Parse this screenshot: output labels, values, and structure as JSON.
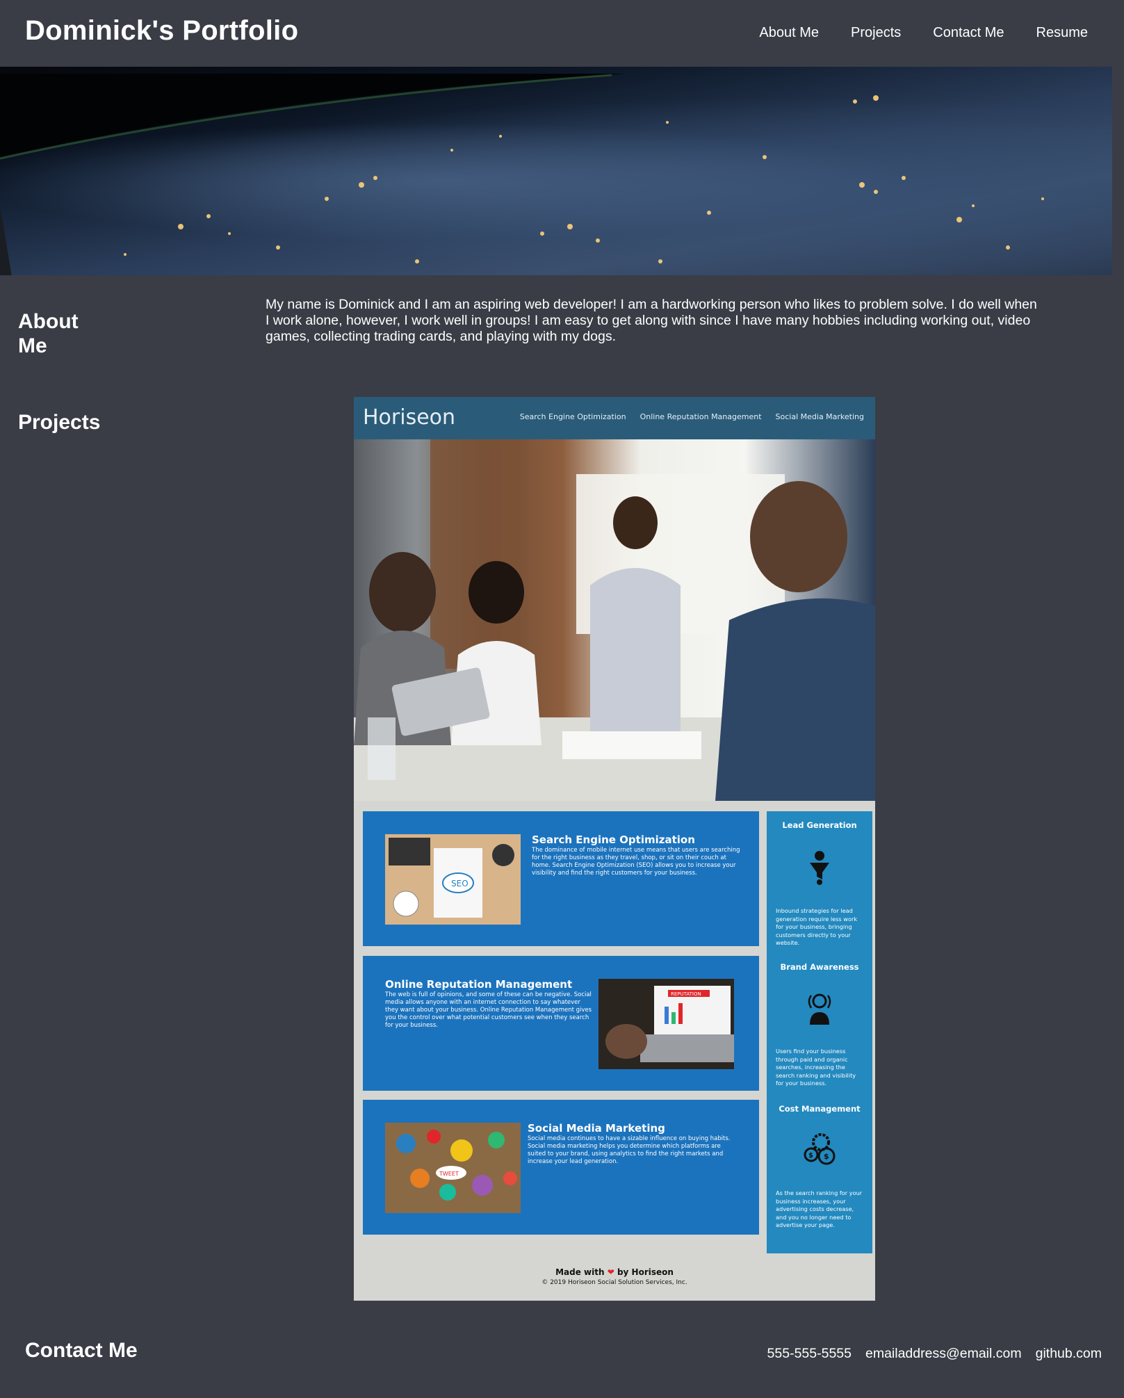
{
  "header": {
    "title": "Dominick's Portfolio",
    "nav": [
      "About Me",
      "Projects",
      "Contact Me",
      "Resume"
    ]
  },
  "about": {
    "heading": "About Me",
    "text": "My name is Dominick and I am an aspiring web developer! I am a hardworking person who likes to problem solve. I do well when I work alone, however, I work well in groups! I am easy to get along with since I have many hobbies including working out, video games, collecting trading cards, and playing with my dogs."
  },
  "projects": {
    "heading": "Projects",
    "screenshot": {
      "logo": "Horiseon",
      "nav": [
        "Search Engine Optimization",
        "Online Reputation Management",
        "Social Media Marketing"
      ],
      "cards": [
        {
          "title": "Search Engine Optimization",
          "text": "The dominance of mobile internet use means that users are searching for the right business as they travel, shop, or sit on their couch at home. Search Engine Optimization (SEO) allows you to increase your visibility and find the right customers for your business."
        },
        {
          "title": "Online Reputation Management",
          "text": "The web is full of opinions, and some of these can be negative. Social media allows anyone with an internet connection to say whatever they want about your business. Online Reputation Management gives you the control over what potential customers see when they search for your business."
        },
        {
          "title": "Social Media Marketing",
          "text": "Social media continues to have a sizable influence on buying habits. Social media marketing helps you determine which platforms are suited to your brand, using analytics to find the right markets and increase your lead generation."
        }
      ],
      "benefits": [
        {
          "title": "Lead Generation",
          "text": "Inbound strategies for lead generation require less work for your business, bringing customers directly to your website."
        },
        {
          "title": "Brand Awareness",
          "text": "Users find your business through paid and organic searches, increasing the search ranking and visibility for your business."
        },
        {
          "title": "Cost Management",
          "text": "As the search ranking for your business increases, your advertising costs decrease, and you no longer need to advertise your page."
        }
      ],
      "footer": {
        "made_prefix": "Made with",
        "heart": "❤",
        "made_suffix": "by Horiseon",
        "copyright": "© 2019 Horiseon Social Solution Services, Inc."
      },
      "photo_labels": {
        "seo": "SEO",
        "reputation": "REPUTATION",
        "tweet": "TWEET"
      }
    }
  },
  "contact": {
    "heading": "Contact Me",
    "phone": "555-555-5555",
    "email": "emailaddress@email.com",
    "github": "github.com"
  },
  "colors": {
    "page_bg": "#3a3d46",
    "text": "#ffffff",
    "horiseon_header": "#2a5c7a",
    "card_blue": "#1c73bd",
    "side_blue": "#2389bf"
  }
}
